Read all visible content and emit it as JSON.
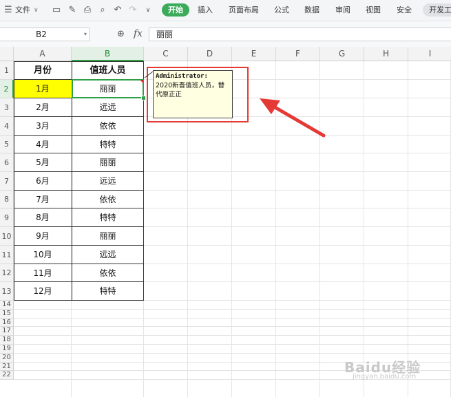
{
  "ribbon": {
    "file_menu": "文件",
    "tabs": [
      "开始",
      "插入",
      "页面布局",
      "公式",
      "数据",
      "审阅",
      "视图",
      "安全",
      "开发工"
    ]
  },
  "formula_bar": {
    "name_box": "B2",
    "fx_label": "fx",
    "value": "丽丽"
  },
  "sheet": {
    "columns": [
      "A",
      "B",
      "C",
      "D",
      "E",
      "F",
      "G",
      "H",
      "I"
    ],
    "rows": [
      "1",
      "2",
      "3",
      "4",
      "5",
      "6",
      "7",
      "8",
      "9",
      "10",
      "11",
      "12",
      "13",
      "14",
      "15",
      "16",
      "17",
      "18",
      "19",
      "20",
      "21",
      "22"
    ],
    "selected_cell": "B2",
    "table_header": [
      "月份",
      "值班人员"
    ],
    "table_rows": [
      [
        "1月",
        "丽丽"
      ],
      [
        "2月",
        "远远"
      ],
      [
        "3月",
        "依依"
      ],
      [
        "4月",
        "特特"
      ],
      [
        "5月",
        "丽丽"
      ],
      [
        "6月",
        "远远"
      ],
      [
        "7月",
        "依依"
      ],
      [
        "8月",
        "特特"
      ],
      [
        "9月",
        "丽丽"
      ],
      [
        "10月",
        "远远"
      ],
      [
        "11月",
        "依依"
      ],
      [
        "12月",
        "特特"
      ]
    ],
    "highlight_color": "#ffff00"
  },
  "comment": {
    "author": "Administrator:",
    "text": "2020新晋值班人员，替代原正正"
  },
  "annotation_color": "#e53935",
  "watermark": {
    "main": "Baidu经验",
    "sub": "jingyan.baidu.com"
  }
}
